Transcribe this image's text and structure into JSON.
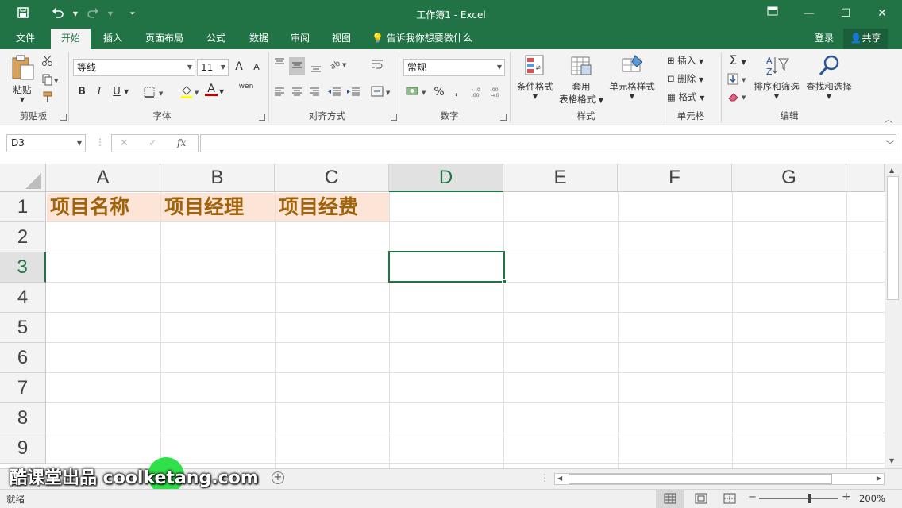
{
  "window": {
    "title": "工作簿1 - Excel",
    "accent": "#217346"
  },
  "qat": {
    "save_icon": "save-icon",
    "undo_icon": "undo-icon",
    "redo_icon": "redo-icon",
    "customize_icon": "customize-icon"
  },
  "tabs": [
    {
      "label": "文件"
    },
    {
      "label": "开始"
    },
    {
      "label": "插入"
    },
    {
      "label": "页面布局"
    },
    {
      "label": "公式"
    },
    {
      "label": "数据"
    },
    {
      "label": "审阅"
    },
    {
      "label": "视图"
    }
  ],
  "tell_me": "告诉我你想要做什么",
  "account": {
    "signin": "登录",
    "share": "共享"
  },
  "ribbon": {
    "clipboard": {
      "label": "剪贴板",
      "paste": "粘贴"
    },
    "font": {
      "label": "字体",
      "font_name": "等线",
      "font_size": "11",
      "bold": "B",
      "italic": "I",
      "underline": "U",
      "font_color": "A",
      "phonetic": "wén",
      "grow": "A",
      "shrink": "A"
    },
    "alignment": {
      "label": "对齐方式"
    },
    "number": {
      "label": "数字",
      "format": "常规",
      "percent": "%",
      "comma": ","
    },
    "styles": {
      "label": "样式",
      "conditional": "条件格式",
      "table_line1": "套用",
      "table_line2": "表格格式",
      "cell_styles": "单元格样式"
    },
    "cells": {
      "label": "单元格",
      "insert": "插入",
      "delete": "删除",
      "format": "格式"
    },
    "editing": {
      "label": "编辑",
      "sort": "排序和筛选",
      "find": "查找和选择",
      "sum": "Σ"
    }
  },
  "formula_bar": {
    "name_box": "D3",
    "formula": "",
    "fx": "fx",
    "cancel": "✕",
    "enter": "✓"
  },
  "grid": {
    "columns": [
      "A",
      "B",
      "C",
      "D",
      "E",
      "F",
      "G"
    ],
    "rows": [
      "1",
      "2",
      "3",
      "4",
      "5",
      "6",
      "7",
      "8",
      "9"
    ],
    "selected_column": "D",
    "selected_row": "3",
    "header_fill": "#fce4d6",
    "header_text_color": "#a0620a",
    "cells": {
      "A1": "项目名称",
      "B1": "项目经理",
      "C1": "项目经费"
    }
  },
  "status": {
    "ready": "就绪",
    "zoom": "200%",
    "minus": "−",
    "plus": "+"
  },
  "watermark": "酷课堂出品 coolketang.com"
}
